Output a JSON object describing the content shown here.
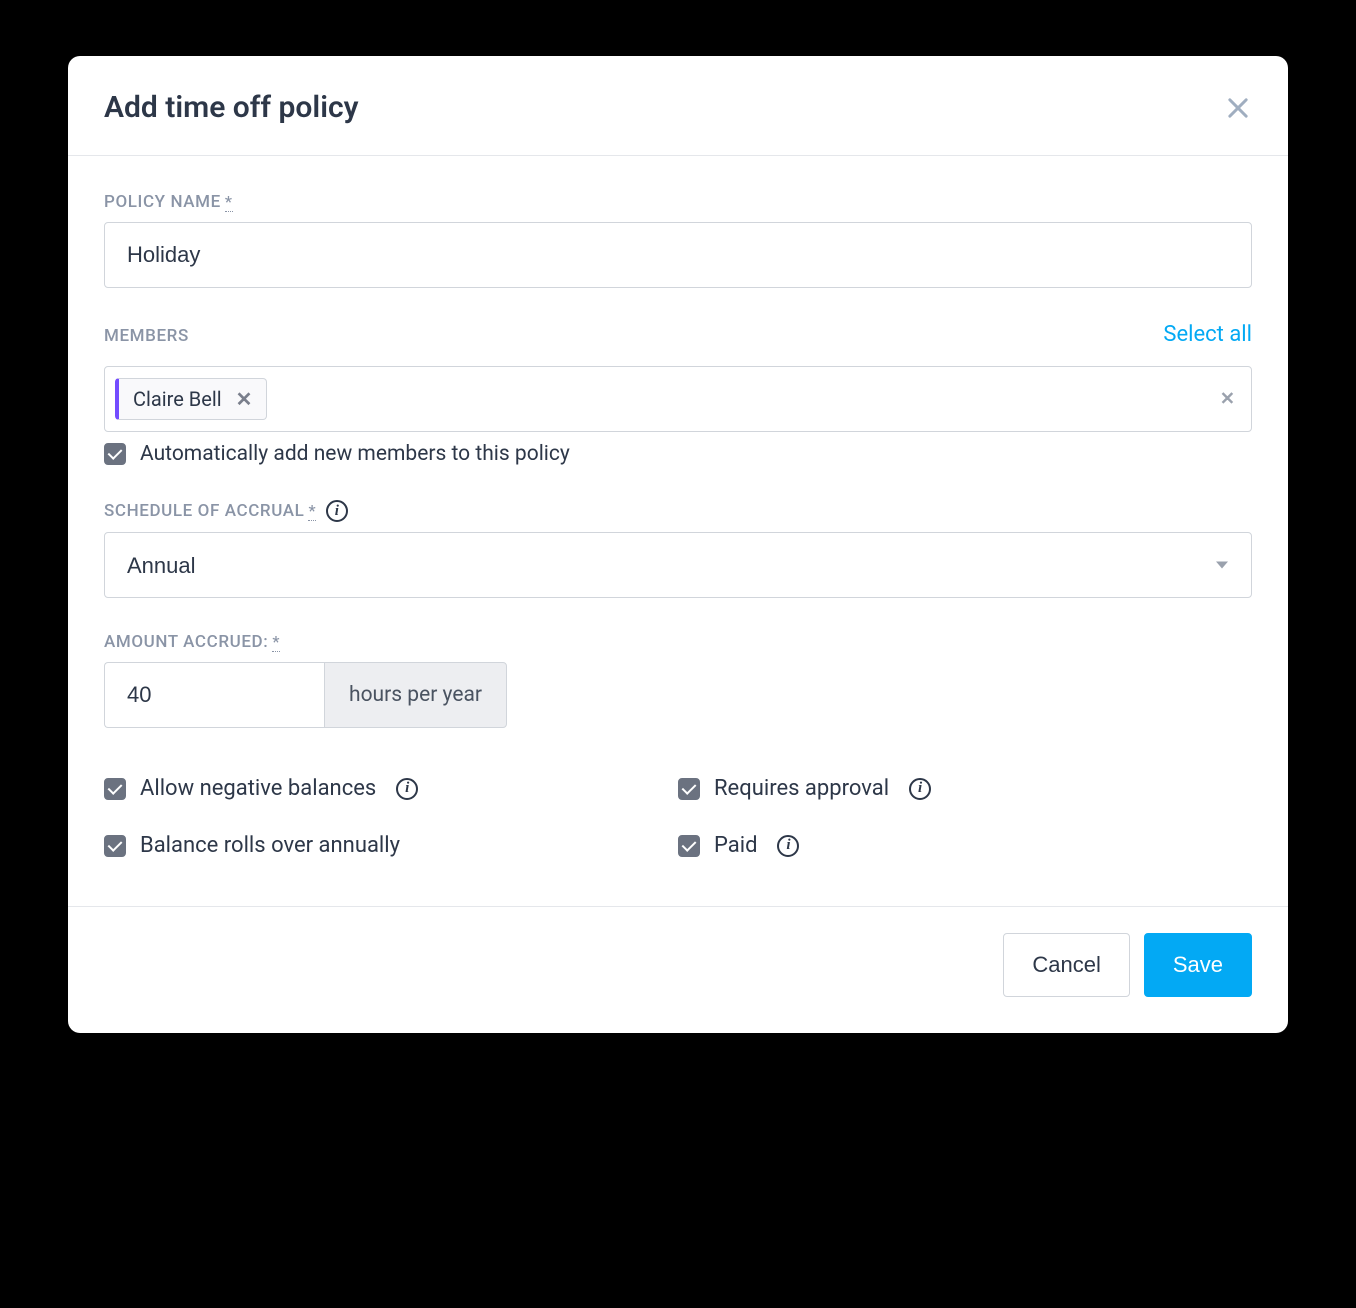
{
  "modal": {
    "title": "Add time off policy"
  },
  "fields": {
    "policy_name_label": "POLICY NAME",
    "policy_name_value": "Holiday",
    "members_label": "MEMBERS",
    "select_all_label": "Select all",
    "members_tags": [
      "Claire Bell"
    ],
    "auto_add_label": "Automatically add new members to this policy",
    "auto_add_checked": true,
    "schedule_label": "SCHEDULE OF ACCRUAL",
    "schedule_value": "Annual",
    "amount_label": "AMOUNT ACCRUED:",
    "amount_value": "40",
    "amount_unit": "hours per year",
    "required_mark": "*"
  },
  "options": {
    "allow_negative_label": "Allow negative balances",
    "allow_negative_checked": true,
    "requires_approval_label": "Requires approval",
    "requires_approval_checked": true,
    "rollover_label": "Balance rolls over annually",
    "rollover_checked": true,
    "paid_label": "Paid",
    "paid_checked": true
  },
  "footer": {
    "cancel_label": "Cancel",
    "save_label": "Save"
  }
}
